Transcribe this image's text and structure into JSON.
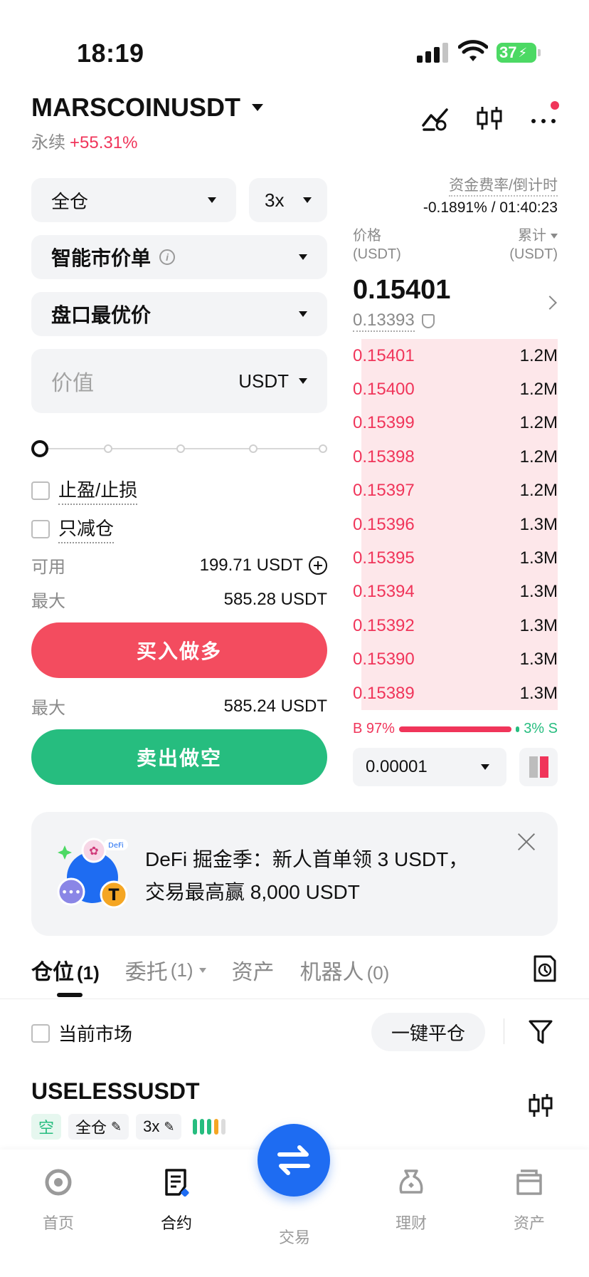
{
  "status_bar": {
    "time": "18:19",
    "battery": "37"
  },
  "header": {
    "symbol": "MARSCOINUSDT",
    "contract_type": "永续",
    "change": "+55.31%"
  },
  "order_form": {
    "margin_mode": "全仓",
    "leverage": "3x",
    "order_type": "智能市价单",
    "price_type": "盘口最优价",
    "value_placeholder": "价值",
    "value_unit": "USDT",
    "tp_sl_label": "止盈/止损",
    "reduce_only_label": "只减仓",
    "available_label": "可用",
    "available_value": "199.71 USDT",
    "max_label": "最大",
    "max_buy_value": "585.28 USDT",
    "buy_label": "买入做多",
    "max_sell_label": "最大",
    "max_sell_value": "585.24 USDT",
    "sell_label": "卖出做空"
  },
  "orderbook": {
    "funding_label": "资金费率/倒计时",
    "funding_value": "-0.1891% / 01:40:23",
    "price_header": "价格",
    "price_unit": "(USDT)",
    "qty_header": "累计",
    "qty_unit": "(USDT)",
    "last_price": "0.15401",
    "mark_price": "0.13393",
    "asks": [
      {
        "price": "0.15401",
        "qty": "1.2M",
        "depth": 0.96
      },
      {
        "price": "0.15400",
        "qty": "1.2M",
        "depth": 0.96
      },
      {
        "price": "0.15399",
        "qty": "1.2M",
        "depth": 0.96
      },
      {
        "price": "0.15398",
        "qty": "1.2M",
        "depth": 0.96
      },
      {
        "price": "0.15397",
        "qty": "1.2M",
        "depth": 0.96
      },
      {
        "price": "0.15396",
        "qty": "1.3M",
        "depth": 0.96
      },
      {
        "price": "0.15395",
        "qty": "1.3M",
        "depth": 0.96
      },
      {
        "price": "0.15394",
        "qty": "1.3M",
        "depth": 0.96
      },
      {
        "price": "0.15392",
        "qty": "1.3M",
        "depth": 0.96
      },
      {
        "price": "0.15390",
        "qty": "1.3M",
        "depth": 0.96
      },
      {
        "price": "0.15389",
        "qty": "1.3M",
        "depth": 0.96
      }
    ],
    "buy_ratio": "B 97%",
    "sell_ratio": "3% S",
    "buy_fraction": 0.97,
    "tick_size": "0.00001"
  },
  "promo": {
    "line1": "DeFi 掘金季：新人首单领 3 USDT，",
    "line2": "交易最高赢 8,000 USDT",
    "badge": "DeFi"
  },
  "tabs": {
    "positions": "仓位",
    "positions_count": "(1)",
    "orders": "委托",
    "orders_count": "(1)",
    "assets": "资产",
    "bots": "机器人",
    "bots_count": "(0)"
  },
  "positions_panel": {
    "current_market_label": "当前市场",
    "close_all_label": "一键平仓",
    "position_symbol": "USELESSUSDT",
    "side_tag": "空",
    "mode_tag": "全仓",
    "leverage_tag": "3x"
  },
  "bottom_nav": {
    "home": "首页",
    "contracts": "合约",
    "trade": "交易",
    "finance": "理财",
    "assets": "资产"
  },
  "colors": {
    "red": "#f0355a",
    "green": "#26bd7f",
    "blue": "#1e6cf2"
  }
}
